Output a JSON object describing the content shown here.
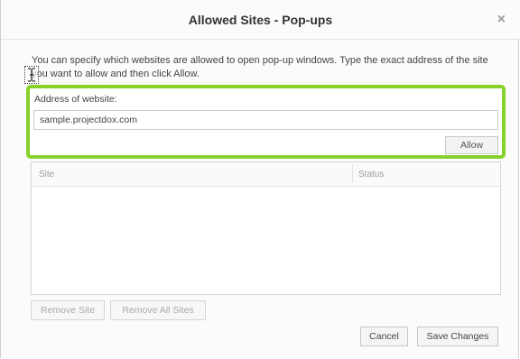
{
  "dialog": {
    "title": "Allowed Sites - Pop-ups",
    "close_glyph": "×",
    "description": "You can specify which websites are allowed to open pop-up windows. Type the exact address of the site you want to allow and then click Allow."
  },
  "address": {
    "label": "Address of website:",
    "value": "sample.projectdox.com",
    "allow_label": "Allow"
  },
  "table": {
    "columns": [
      "Site",
      "Status"
    ],
    "rows": []
  },
  "buttons": {
    "remove_site": "Remove Site",
    "remove_all": "Remove All Sites",
    "cancel": "Cancel",
    "save": "Save Changes"
  },
  "highlight_color": "#86d12a",
  "icons": {
    "cursor": "text-cursor-icon",
    "close": "close-icon"
  }
}
